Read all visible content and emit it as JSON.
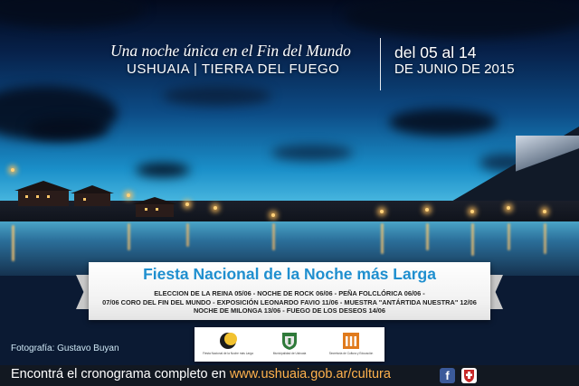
{
  "header": {
    "tagline": "Una noche única en el Fin del Mundo",
    "location": "USHUAIA | TIERRA DEL FUEGO",
    "date_line1": "del 05 al 14",
    "date_line2": "DE JUNIO DE 2015"
  },
  "banner": {
    "title": "Fiesta Nacional de la Noche más Larga",
    "events": [
      "ELECCION DE LA REINA 05/06 - NOCHE DE ROCK 06/06 - PEÑA FOLCLÓRICA 06/06 -",
      "07/06 CORO DEL FIN DEL MUNDO - EXPOSICIÓN LEONARDO FAVIO 11/06 - MUESTRA \"ANTÁRTIDA NUESTRA\" 12/06",
      "NOCHE DE MILONGA 13/06 - FUEGO DE LOS DESEOS 14/06"
    ]
  },
  "credit": "Fotografía: Gustavo Buyan",
  "logos": [
    {
      "name": "fiesta-logo",
      "caption": "Fiesta Nacional de la Noche más Larga"
    },
    {
      "name": "municipio-logo",
      "caption": "Municipalidad de Ushuaia"
    },
    {
      "name": "cultura-logo",
      "caption": "Secretaría de Cultura y Educación"
    }
  ],
  "footer": {
    "prefix": "Encontrá el cronograma completo en ",
    "url": "www.ushuaia.gob.ar/cultura"
  },
  "social": {
    "facebook_icon": "facebook-icon",
    "shield_icon": "municipal-shield-icon"
  },
  "colors": {
    "title_blue": "#1f8fcf",
    "url_orange": "#ffb24d",
    "footer_bg": "#121821"
  }
}
